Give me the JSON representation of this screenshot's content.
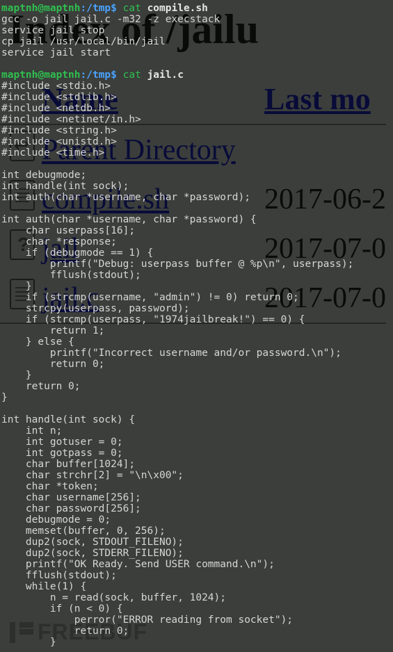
{
  "bg": {
    "title": "Index of /jailu",
    "headers": {
      "name": "Name",
      "last_mod": "Last mo"
    },
    "rows": [
      {
        "icon": "back",
        "name": "Parent Directory",
        "date": ""
      },
      {
        "icon": "sh",
        "name": "compile.sh",
        "date": "2017-06-2"
      },
      {
        "icon": "unknown",
        "name": "jail",
        "date": "2017-07-0"
      },
      {
        "icon": "txt",
        "name": "jail.c",
        "date": "2017-07-0"
      }
    ]
  },
  "watermark": "FREEBUF",
  "terminal": {
    "prompts": [
      {
        "user": "maptnh@maptnh",
        "path": ":/tmp",
        "dollar": "$",
        "cmd": "cat",
        "arg": "compile.sh"
      },
      {
        "user": "maptnh@maptnh",
        "path": ":/tmp",
        "dollar": "$",
        "cmd": "cat",
        "arg": "jail.c"
      }
    ],
    "blocks": {
      "compile": "gcc -o jail jail.c -m32 -z execstack\nservice jail stop\ncp jail /usr/local/bin/jail\nservice jail start",
      "jail": "#include <stdio.h>\n#include <stdlib.h>\n#include <netdb.h>\n#include <netinet/in.h>\n#include <string.h>\n#include <unistd.h>\n#include <time.h>\n\nint debugmode;\nint handle(int sock);\nint auth(char *username, char *password);\n\nint auth(char *username, char *password) {\n    char userpass[16];\n    char *response;\n    if (debugmode == 1) {\n        printf(\"Debug: userpass buffer @ %p\\n\", userpass);\n        fflush(stdout);\n    }\n    if (strcmp(username, \"admin\") != 0) return 0;\n    strcpy(userpass, password);\n    if (strcmp(userpass, \"1974jailbreak!\") == 0) {\n        return 1;\n    } else {\n        printf(\"Incorrect username and/or password.\\n\");\n        return 0;\n    }\n    return 0;\n}\n\nint handle(int sock) {\n    int n;\n    int gotuser = 0;\n    int gotpass = 0;\n    char buffer[1024];\n    char strchr[2] = \"\\n\\x00\";\n    char *token;\n    char username[256];\n    char password[256];\n    debugmode = 0;\n    memset(buffer, 0, 256);\n    dup2(sock, STDOUT_FILENO);\n    dup2(sock, STDERR_FILENO);\n    printf(\"OK Ready. Send USER command.\\n\");\n    fflush(stdout);\n    while(1) {\n        n = read(sock, buffer, 1024);\n        if (n < 0) {\n            perror(\"ERROR reading from socket\");\n            return 0;\n        }"
    }
  }
}
